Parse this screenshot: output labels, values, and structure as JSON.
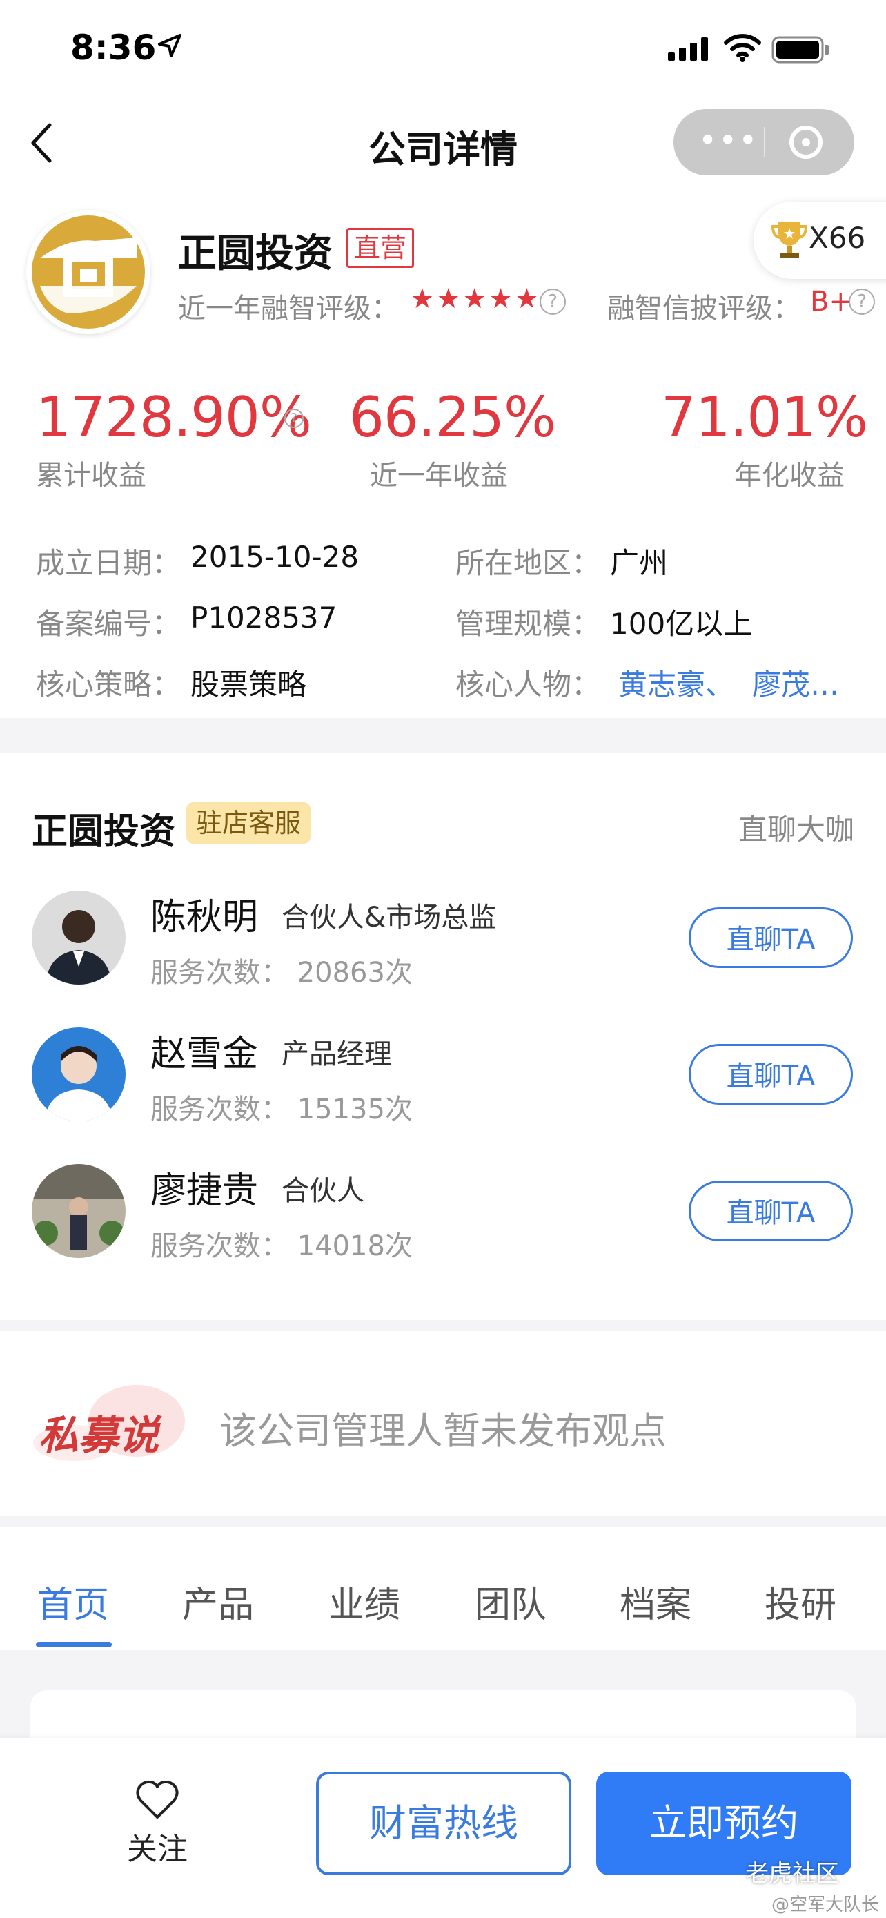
{
  "status": {
    "time": "8:36"
  },
  "nav": {
    "title": "公司详情",
    "more": "•••"
  },
  "company": {
    "name": "正圆投资",
    "tag": "直营",
    "trophy_count": "X66",
    "rating_label": "近一年融智评级：",
    "stars": "★★★★★",
    "disclosure_label": "融智信披评级：",
    "disclosure_value": "B+"
  },
  "stats": [
    {
      "value": "1728.90%",
      "label": "累计收益"
    },
    {
      "value": "66.25%",
      "label": "近一年收益"
    },
    {
      "value": "71.01%",
      "label": "年化收益"
    }
  ],
  "info": {
    "founded_label": "成立日期：",
    "founded_value": "2015-10-28",
    "region_label": "所在地区：",
    "region_value": "广州",
    "record_label": "备案编号：",
    "record_value": "P1028537",
    "scale_label": "管理规模：",
    "scale_value": "100亿以上",
    "strategy_label": "核心策略：",
    "strategy_value": "股票策略",
    "people_label": "核心人物：",
    "people_1": "黄志豪、",
    "people_2": "廖茂…"
  },
  "service": {
    "title": "正圆投资",
    "tag": "驻店客服",
    "link": "直聊大咖",
    "chat_label": "直聊TA",
    "people": [
      {
        "name": "陈秋明",
        "role": "合伙人&市场总监",
        "count": "服务次数：  20863次"
      },
      {
        "name": "赵雪金",
        "role": "产品经理",
        "count": "服务次数：  15135次"
      },
      {
        "name": "廖捷贵",
        "role": "合伙人",
        "count": "服务次数：  14018次"
      }
    ]
  },
  "opinion": {
    "logo": "私募说",
    "text": "该公司管理人暂未发布观点"
  },
  "tabs": [
    "首页",
    "产品",
    "业绩",
    "团队",
    "档案",
    "投研"
  ],
  "bottom": {
    "follow": "关注",
    "hotline": "财富热线",
    "book": "立即预约"
  },
  "watermark": {
    "line1": "老虎社区",
    "line2": "@空军大队长"
  },
  "colors": {
    "accent_blue": "#3a7be0",
    "red": "#e0383e",
    "gold": "#d9a93a"
  }
}
